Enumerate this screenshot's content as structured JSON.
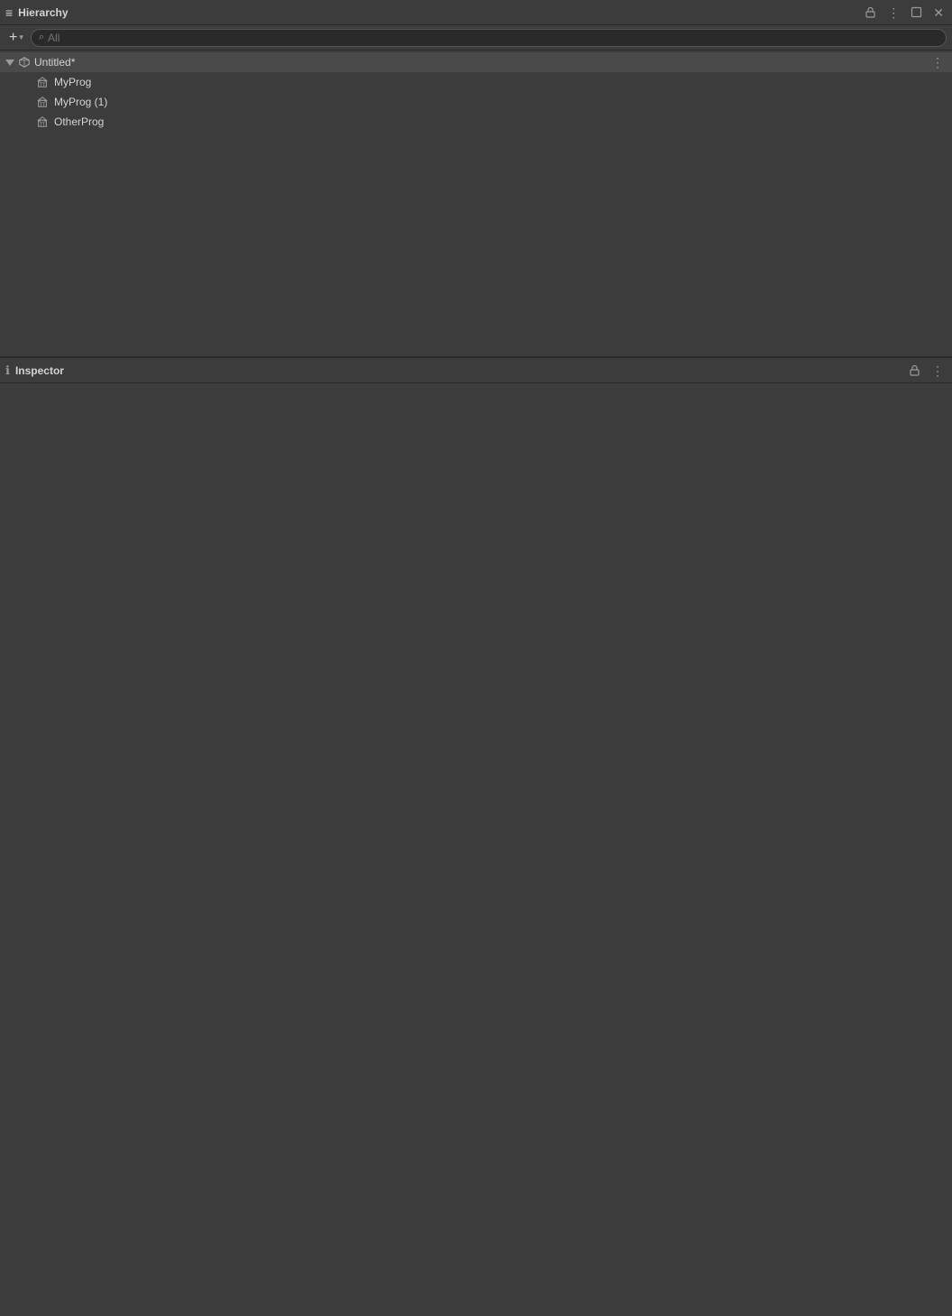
{
  "hierarchy": {
    "title": "Hierarchy",
    "search_placeholder": "All",
    "add_button_label": "+",
    "scene": {
      "name": "Untitled*",
      "game_objects": [
        {
          "name": "MyProg"
        },
        {
          "name": "MyProg (1)"
        },
        {
          "name": "OtherProg"
        }
      ]
    }
  },
  "inspector": {
    "title": "Inspector"
  },
  "icons": {
    "hamburger": "≡",
    "add": "+",
    "chevron_down": "▾",
    "search": "⌕",
    "lock": "🔒",
    "three_dots": "⋮",
    "window_minimize": "▭",
    "window_close": "✕"
  },
  "colors": {
    "bg_main": "#3c3c3c",
    "bg_dark": "#2a2a2a",
    "bg_selected": "#4a4a4a",
    "text_primary": "#d4d4d4",
    "text_secondary": "#9a9a9a",
    "accent": "#aaaaaa"
  }
}
